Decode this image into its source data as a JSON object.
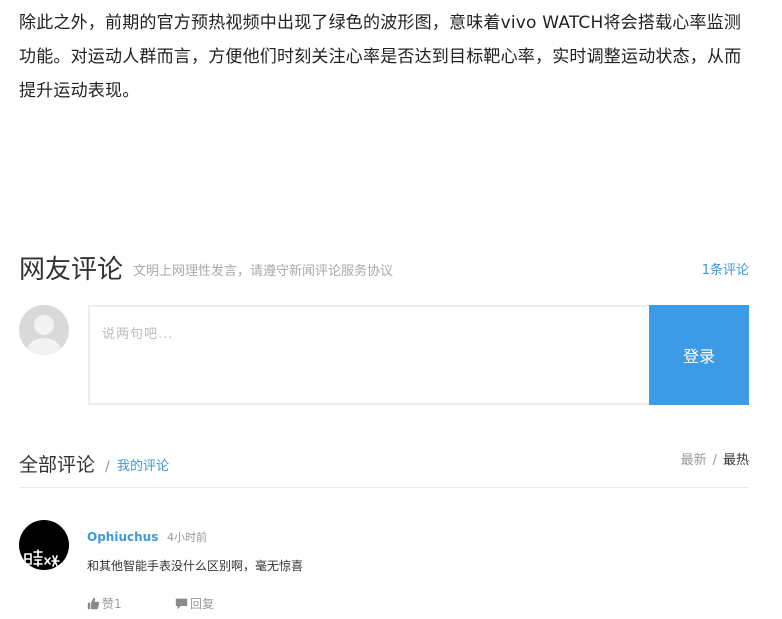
{
  "article": {
    "paragraph": "除此之外，前期的官方预热视频中出现了绿色的波形图，意味着vivo WATCH将会搭载心率监测功能。对运动人群而言，方便他们时刻关注心率是否达到目标靶心率，实时调整运动状态，从而提升运动表现。"
  },
  "comments": {
    "title": "网友评论",
    "note": "文明上网理性发言，请遵守新闻评论服务协议",
    "count": "1条评论",
    "input_placeholder": "说两句吧...",
    "login_label": "登录",
    "all_title": "全部评论",
    "separator": "/",
    "my_comments": "我的评论",
    "sort_new": "最新",
    "sort_slash": "/",
    "sort_hot": "最热",
    "items": [
      {
        "user": "Ophiuchus",
        "time": "4小时前",
        "text": "和其他智能手表没什么区别啊，毫无惊喜",
        "like_label": "赞1",
        "reply_label": "回复"
      }
    ]
  },
  "icons": {
    "like": "thumbs-up-icon",
    "reply": "speech-bubble-icon",
    "avatar_default": "default-avatar-icon"
  },
  "colors": {
    "accent": "#3d9ae4",
    "link": "#3c9ad8",
    "muted": "#999999"
  }
}
